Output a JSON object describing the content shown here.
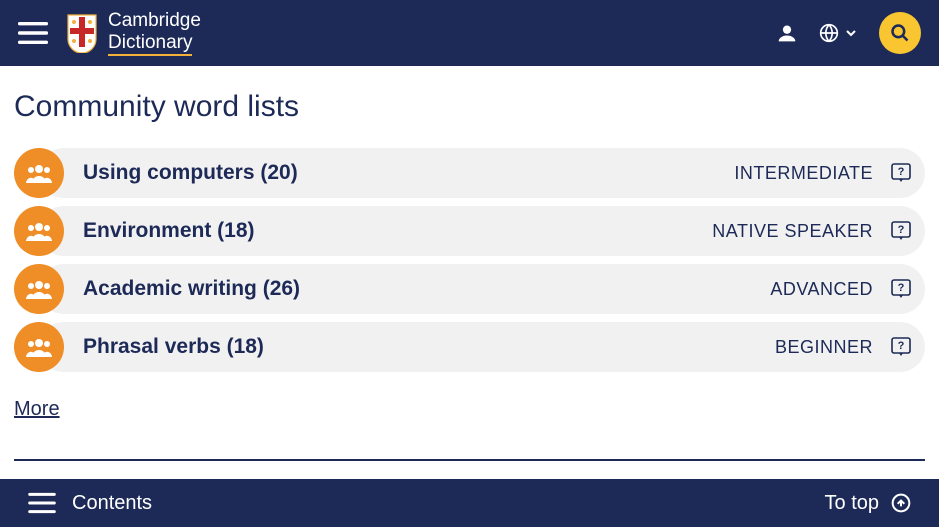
{
  "header": {
    "brand_line1": "Cambridge",
    "brand_line2": "Dictionary"
  },
  "page": {
    "title": "Community word lists",
    "more_label": "More"
  },
  "lists": [
    {
      "title": "Using computers (20)",
      "level": "INTERMEDIATE"
    },
    {
      "title": "Environment (18)",
      "level": "NATIVE SPEAKER"
    },
    {
      "title": "Academic writing (26)",
      "level": "ADVANCED"
    },
    {
      "title": "Phrasal verbs (18)",
      "level": "BEGINNER"
    }
  ],
  "footer": {
    "contents_label": "Contents",
    "to_top_label": "To top"
  }
}
